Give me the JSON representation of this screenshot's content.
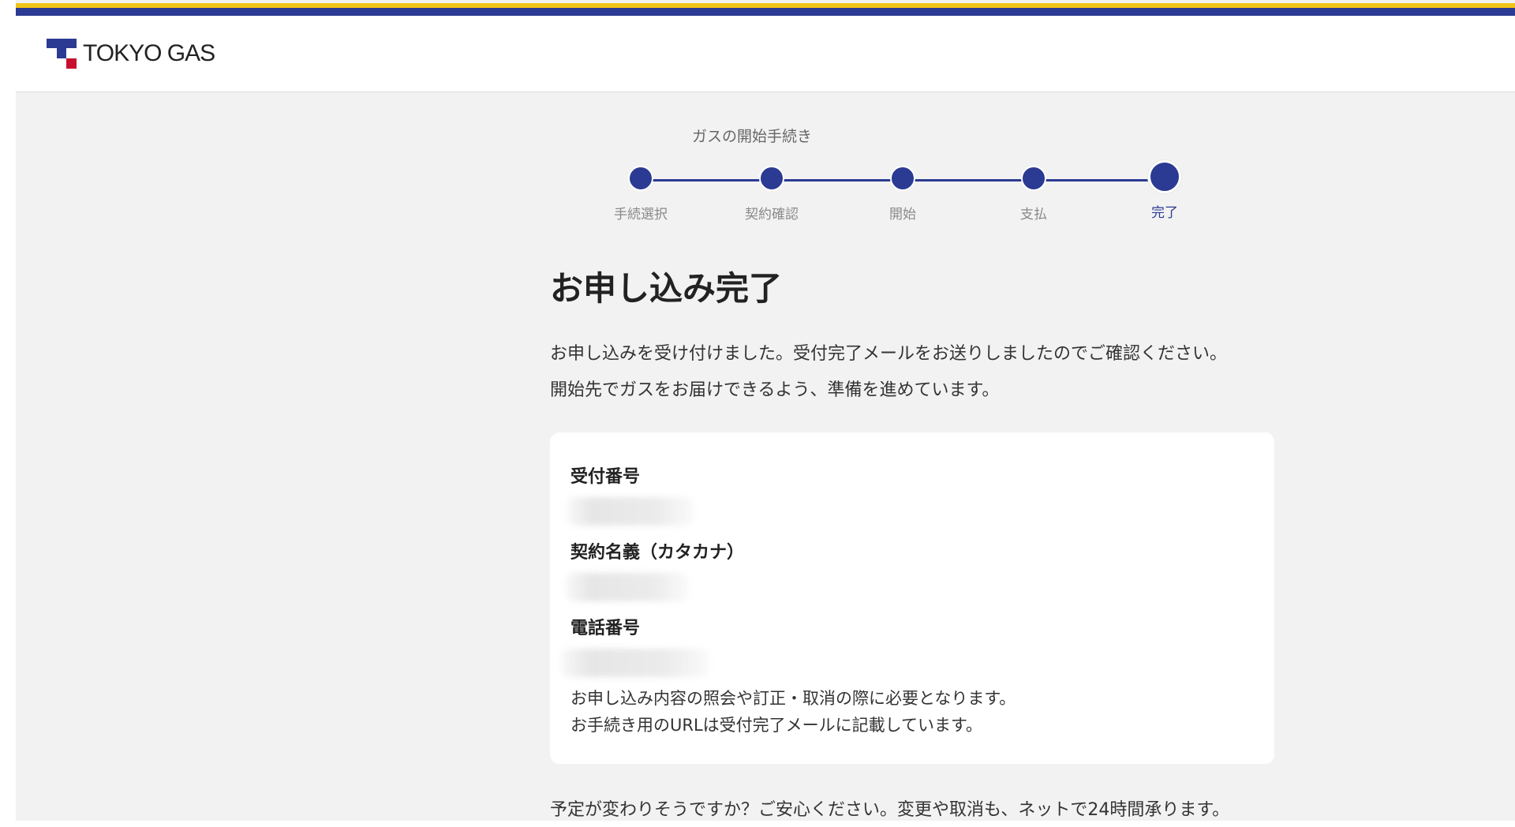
{
  "brand": {
    "name": "TOKYO GAS",
    "colors": {
      "primary": "#2b3a92",
      "accent_yellow": "#f0c419",
      "accent_red": "#c8102e"
    }
  },
  "stepper": {
    "title": "ガスの開始手続き",
    "current_step": 5,
    "steps": [
      {
        "label": "手続選択",
        "status": "done"
      },
      {
        "label": "契約確認",
        "status": "done"
      },
      {
        "label": "開始",
        "status": "done"
      },
      {
        "label": "支払",
        "status": "done"
      },
      {
        "label": "完了",
        "status": "current"
      }
    ]
  },
  "main": {
    "title": "お申し込み完了",
    "lead_line1": "お申し込みを受け付けました。受付完了メールをお送りしましたのでご確認ください。",
    "lead_line2": "開始先でガスをお届けできるよう、準備を進めています。"
  },
  "card": {
    "fields": [
      {
        "label": "受付番号",
        "value_redacted": true
      },
      {
        "label": "契約名義（カタカナ）",
        "value_redacted": true
      },
      {
        "label": "電話番号",
        "value_redacted": true
      }
    ],
    "note_line1": "お申し込み内容の照会や訂正・取消の際に必要となります。",
    "note_line2": "お手続き用のURLは受付完了メールに記載しています。"
  },
  "footer_text": "予定が変わりそうですか？ご安心ください。変更や取消も、ネットで24時間承ります。"
}
